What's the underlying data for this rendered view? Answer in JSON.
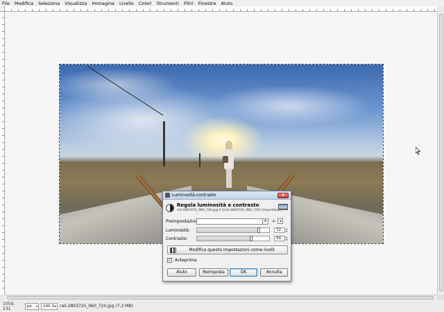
{
  "menu": [
    "File",
    "Modifica",
    "Seleziona",
    "Visualizza",
    "Immagine",
    "Livello",
    "Colori",
    "Strumenti",
    "Filtri",
    "Finestre",
    "Aiuto"
  ],
  "dialog": {
    "window_title": "Luminosità-contrasto",
    "close_label": "x",
    "heading": "Regola luminosità e contrasto",
    "subtitle": "rail-2803725_960_720.jpg-2 ([rail-2803725_960_720] (importata))",
    "presets_label": "Preimpostazioni:",
    "presets_value": "",
    "add_preset_glyph": "+",
    "preset_menu_glyph": "◂",
    "brightness_label": "Luminosità:",
    "brightness_value": "72",
    "brightness_level": 0.86,
    "contrast_label": "Contrasto:",
    "contrast_value": "50",
    "contrast_level": 0.75,
    "edit_levels_label": "Modifica queste impostazioni come livelli",
    "preview_label": "Anteprima",
    "preview_checked": true,
    "help_button": "Aiuto",
    "reset_button": "Reimposta",
    "ok_button": "OK",
    "cancel_button": "Annulla"
  },
  "status": {
    "coords": "1059, 231",
    "unit": "px",
    "zoom": "100 %",
    "file_info": "rail-2803725_960_720.jpg (7,3 MB)"
  }
}
